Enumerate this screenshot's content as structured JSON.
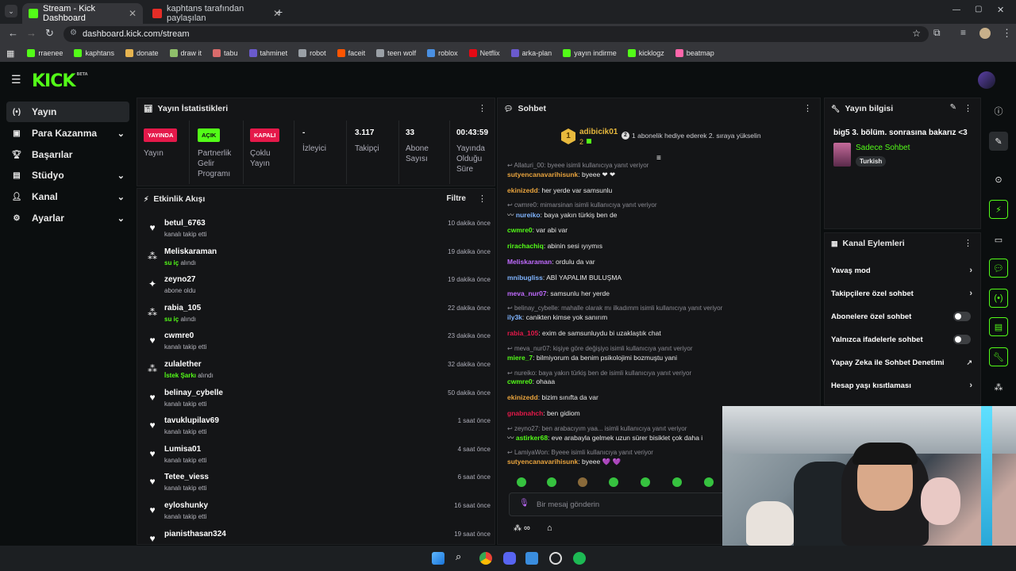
{
  "browser": {
    "tabs": [
      {
        "title": "Stream - Kick Dashboard",
        "favicon": "kick-icon"
      },
      {
        "title": "kaphtans tarafından paylaşılan",
        "favicon": "youtube-icon"
      }
    ],
    "url": "dashboard.kick.com/stream",
    "bookmarks": [
      {
        "label": "rraenee",
        "color": "#53fc18"
      },
      {
        "label": "kaphtans",
        "color": "#53fc18"
      },
      {
        "label": "donate",
        "color": "#e6b450"
      },
      {
        "label": "draw it",
        "color": "#8fbf6a"
      },
      {
        "label": "tabu",
        "color": "#d96b6b"
      },
      {
        "label": "tahminet",
        "color": "#6a5acd"
      },
      {
        "label": "robot",
        "color": "#9aa0a6"
      },
      {
        "label": "faceit",
        "color": "#ff5500"
      },
      {
        "label": "teen wolf",
        "color": "#9aa0a6"
      },
      {
        "label": "roblox",
        "color": "#4a90e2"
      },
      {
        "label": "Netflix",
        "color": "#e50914"
      },
      {
        "label": "arka-plan",
        "color": "#6a5acd"
      },
      {
        "label": "yayın indirme",
        "color": "#53fc18"
      },
      {
        "label": "kicklogz",
        "color": "#53fc18"
      },
      {
        "label": "beatmap",
        "color": "#ff66aa"
      }
    ]
  },
  "kick": {
    "logo": "KICK",
    "logo_badge": "BETA"
  },
  "sidebar": {
    "items": [
      {
        "label": "Yayın",
        "icon": "broadcast-icon",
        "active": true
      },
      {
        "label": "Para Kazanma",
        "icon": "money-icon",
        "chevron": true
      },
      {
        "label": "Başarılar",
        "icon": "trophy-icon"
      },
      {
        "label": "Stüdyo",
        "icon": "studio-icon",
        "chevron": true
      },
      {
        "label": "Kanal",
        "icon": "user-icon",
        "chevron": true
      },
      {
        "label": "Ayarlar",
        "icon": "gear-icon",
        "chevron": true
      }
    ]
  },
  "stats": {
    "title": "Yayın İstatistikleri",
    "cells": [
      {
        "badge": "YAYINDA",
        "badge_color": "#e5194a",
        "label": "Yayın"
      },
      {
        "badge": "AÇIK",
        "badge_color": "#53fc18",
        "label": "Partnerlik Gelir Programı"
      },
      {
        "badge": "KAPALI",
        "badge_color": "#e5194a",
        "label": "Çoklu Yayın"
      },
      {
        "value": "-",
        "label": "İzleyici"
      },
      {
        "value": "3.117",
        "label": "Takipçi"
      },
      {
        "value": "33",
        "label": "Abone Sayısı"
      },
      {
        "value": "00:43:59",
        "label": "Yayında Olduğu Süre"
      }
    ]
  },
  "events": {
    "title": "Etkinlik Akışı",
    "filter": "Filtre",
    "items": [
      {
        "name": "betul_6763",
        "desc": "kanalı takip etti",
        "time": "10 dakika önce",
        "icon": "heart-icon"
      },
      {
        "name": "Meliskaraman",
        "hl": "su iç",
        "desc": " alındı",
        "time": "19 dakika önce",
        "icon": "points-icon"
      },
      {
        "name": "zeyno27",
        "desc": "abone oldu",
        "time": "19 dakika önce",
        "icon": "star-icon"
      },
      {
        "name": "rabia_105",
        "hl": "su iç",
        "desc": " alındı",
        "time": "22 dakika önce",
        "icon": "points-icon"
      },
      {
        "name": "cwmre0",
        "desc": "kanalı takip etti",
        "time": "23 dakika önce",
        "icon": "heart-icon"
      },
      {
        "name": "zulalether",
        "hl": "İstek Şarkı",
        "desc": " alındı",
        "time": "32 dakika önce",
        "icon": "points-icon"
      },
      {
        "name": "belinay_cybelle",
        "desc": "kanalı takip etti",
        "time": "50 dakika önce",
        "icon": "heart-icon"
      },
      {
        "name": "tavuklupilav69",
        "desc": "kanalı takip etti",
        "time": "1 saat önce",
        "icon": "heart-icon"
      },
      {
        "name": "Lumisa01",
        "desc": "kanalı takip etti",
        "time": "4 saat önce",
        "icon": "heart-icon"
      },
      {
        "name": "Tetee_viess",
        "desc": "kanalı takip etti",
        "time": "6 saat önce",
        "icon": "heart-icon"
      },
      {
        "name": "eyloshunky",
        "desc": "kanalı takip etti",
        "time": "16 saat önce",
        "icon": "heart-icon"
      },
      {
        "name": "pianisthasan324",
        "desc": "",
        "time": "19 saat önce",
        "icon": "heart-icon"
      }
    ]
  },
  "chat": {
    "title": "Sohbet",
    "pinned": {
      "rank": "1",
      "user": "adibicik01",
      "count": "2",
      "text": "1 abonelik hediye ederek 2. sıraya yükselin"
    },
    "messages": [
      {
        "reply": "Allaturi_00: byeee isimli kullanıcıya yanıt veriyor"
      },
      {
        "user": "sutyencanavarihisunk",
        "color": "#e8a33d",
        "text": "byeee ❤ ❤"
      },
      {
        "user": "ekinizedd",
        "color": "#e8a33d",
        "text": "her yerde var samsunlu"
      },
      {
        "reply": "cwmre0: mimarsinan isimli kullanıcıya yanıt veriyor"
      },
      {
        "user": "nureiko",
        "color": "#7fb4ff",
        "text": "baya yakın türkiş ben de",
        "prefix": "〰 "
      },
      {
        "user": "cwmre0",
        "color": "#53fc18",
        "text": "var abi var"
      },
      {
        "user": "rirachachiq",
        "color": "#53fc18",
        "text": "abinin sesi ıyıymıs"
      },
      {
        "user": "Meliskaraman",
        "color": "#c06bff",
        "text": "ordulu da var"
      },
      {
        "user": "mnibugliss",
        "color": "#7fb4ff",
        "text": "ABİ YAPALIM BULUŞMA"
      },
      {
        "user": "meva_nur07",
        "color": "#c06bff",
        "text": "samsunlu her yerde"
      },
      {
        "reply": "belinay_cybelle: mahalle olarak mı ilkadımm isimli kullanıcıya yanıt veriyor"
      },
      {
        "user": "ily3k",
        "color": "#7fb4ff",
        "text": "canikten kimse yok sanırım"
      },
      {
        "user": "rabia_105",
        "color": "#e5194a",
        "text": "exim de samsunluydu bi uzaklaştık chat"
      },
      {
        "reply": "meva_nur07: kişiye göre değişiyo isimli kullanıcıya yanıt veriyor"
      },
      {
        "user": "miere_7",
        "color": "#53fc18",
        "text": "bilmiyorum da benim psikolojimi bozmuştu yani"
      },
      {
        "reply": "nureiko: baya yakın türkiş ben de isimli kullanıcıya yanıt veriyor"
      },
      {
        "user": "cwmre0",
        "color": "#53fc18",
        "text": "ohaaa"
      },
      {
        "user": "ekinizedd",
        "color": "#e8a33d",
        "text": "bizim sınıfta da var"
      },
      {
        "user": "gnabnahch",
        "color": "#e5194a",
        "text": "ben gidiom"
      },
      {
        "reply": "zeyno27: ben arabacıyım yaa... isimli kullanıcıya yanıt veriyor"
      },
      {
        "user": "astirker68",
        "color": "#53fc18",
        "text": "eve arabayla gelmek uzun sürer bisiklet çok daha i",
        "prefix": "〰 "
      },
      {
        "reply": "LamiyaWon: Byeee isimli kullanıcıya yanıt veriyor"
      },
      {
        "user": "sutyencanavarihisunk",
        "color": "#e8a33d",
        "text": "byeee 💜 💜"
      }
    ],
    "input_placeholder": "Bir mesaj gönderin",
    "points": "∞"
  },
  "stream_info": {
    "title": "Yayın bilgisi",
    "stream_title": "big5 3. bölüm. sonrasına bakarız <3",
    "category": "Sadece Sohbet",
    "tag": "Turkish"
  },
  "channel_actions": {
    "title": "Kanal Eylemleri",
    "items": [
      {
        "label": "Yavaş mod",
        "control": "chevron"
      },
      {
        "label": "Takipçilere özel sohbet",
        "control": "chevron"
      },
      {
        "label": "Abonelere özel sohbet",
        "control": "toggle"
      },
      {
        "label": "Yalnızca ifadelerle sohbet",
        "control": "toggle"
      },
      {
        "label": "Yapay Zeka ile Sohbet Denetimi",
        "control": "external"
      },
      {
        "label": "Hesap yaşı kısıtlaması",
        "control": "chevron"
      }
    ]
  },
  "colors": {
    "accent": "#53fc18",
    "live": "#e5194a",
    "bg": "#0b0e0f",
    "panel": "#141517"
  }
}
